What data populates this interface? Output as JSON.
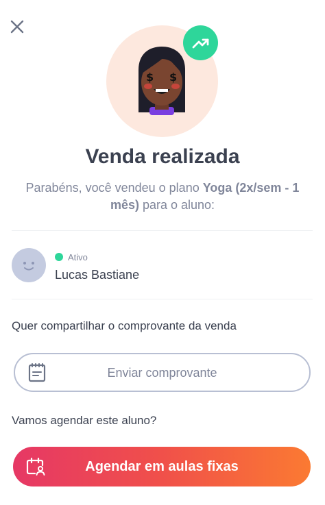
{
  "dialog": {
    "title": "Venda realizada",
    "subtitle_prefix": "Parabéns, você vendeu o plano ",
    "plan_name": "Yoga (2x/sem - 1 mês)",
    "subtitle_suffix": " para o aluno:"
  },
  "student": {
    "status": "Ativo",
    "status_color": "#2ed69a",
    "name": "Lucas Bastiane"
  },
  "share": {
    "question": "Quer compartilhar o comprovante da venda",
    "button_label": "Enviar comprovante"
  },
  "schedule": {
    "question": "Vamos agendar este aluno?",
    "button_label": "Agendar em aulas fixas"
  },
  "icons": {
    "close": "close-icon",
    "trend": "trending-up-icon",
    "receipt": "receipt-icon",
    "calendar": "calendar-user-icon"
  },
  "colors": {
    "accent_green": "#2ed69a",
    "gradient_start": "#e63865",
    "gradient_end": "#fb7a32",
    "hero_bg": "#fde8de"
  }
}
